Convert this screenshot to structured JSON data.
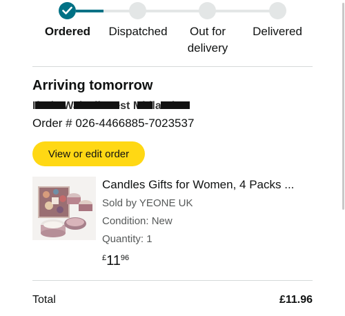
{
  "tracker": {
    "steps": [
      {
        "label": "Ordered",
        "status": "complete"
      },
      {
        "label": "Dispatched",
        "status": "pending"
      },
      {
        "label": "Out for delivery",
        "status": "pending"
      },
      {
        "label": "Delivered",
        "status": "pending"
      }
    ],
    "check_icon": "check-icon"
  },
  "order": {
    "arrival": "Arriving tomorrow",
    "address_redacted": "Ifazla Walsall West Midlands",
    "number_label": "Order # 026-4466885-7023537",
    "edit_button": "View or edit order"
  },
  "product": {
    "title": "Candles Gifts for Women, 4 Packs ...",
    "seller": "Sold by YEONE UK",
    "condition": "Condition: New",
    "quantity": "Quantity: 1",
    "price_symbol": "£",
    "price_whole": "11",
    "price_fraction": "96"
  },
  "summary": {
    "total_label": "Total",
    "total_value": "£11.96"
  },
  "colors": {
    "accent": "#007185",
    "button": "#ffd814",
    "track_inactive": "#e3e6e6"
  }
}
